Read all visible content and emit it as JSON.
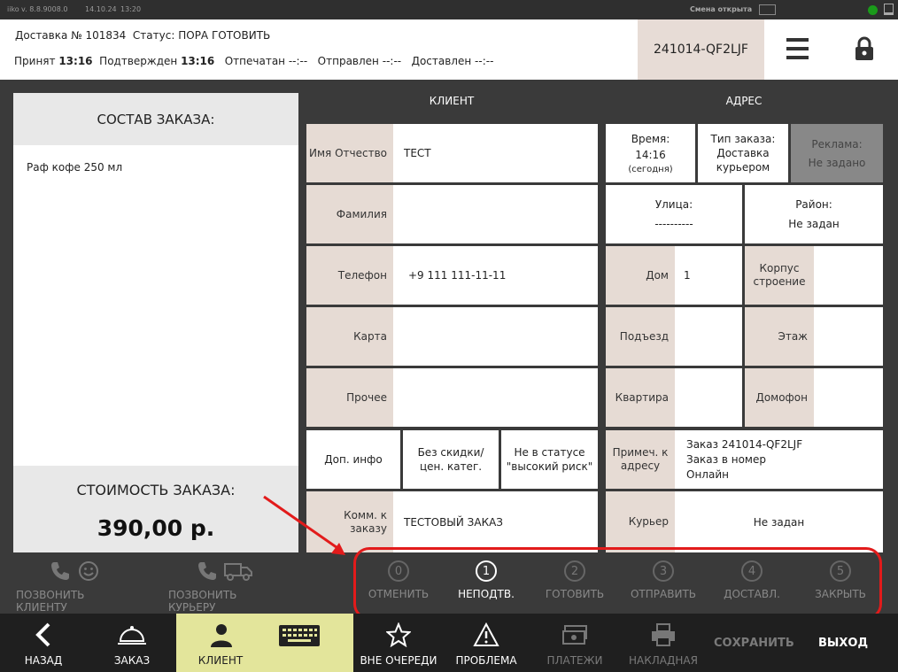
{
  "titlebar": {
    "app": "iiko",
    "version": "v. 8.8.9008.0",
    "date": "14.10.24",
    "time": "13:20",
    "shift": "Смена открыта"
  },
  "header": {
    "delivery_label": "Доставка №",
    "delivery_number": "101834",
    "status_label": "Статус:",
    "status_value": "ПОРА ГОТОВИТЬ",
    "accepted_label": "Принят",
    "accepted_time": "13:16",
    "confirmed_label": "Подтвержден",
    "confirmed_time": "13:16",
    "printed_label": "Отпечатан",
    "printed_time": "--:--",
    "sent_label": "Отправлен",
    "sent_time": "--:--",
    "delivered_label": "Доставлен",
    "delivered_time": "--:--",
    "order_code": "241014-QF2LJF"
  },
  "composition": {
    "title": "СОСТАВ ЗАКАЗА:",
    "items": [
      "Раф  кофе 250 мл"
    ],
    "cost_label": "СТОИМОСТЬ ЗАКАЗА:",
    "cost_value": "390,00 р."
  },
  "client": {
    "title": "КЛИЕНТ",
    "name_label": "Имя Отчество",
    "name_value": "ТЕСТ",
    "surname_label": "Фамилия",
    "surname_value": "",
    "phone_label": "Телефон",
    "phone_value": "+9 111 111-11-11",
    "card_label": "Карта",
    "card_value": "",
    "other_label": "Прочее",
    "other_value": "",
    "extra_info": "Доп. инфо",
    "no_discount": "Без скидки/ цен. катег.",
    "not_risk": "Не в статусе \"высокий риск\"",
    "comment_label": "Комм. к заказу",
    "comment_value": "ТЕСТОВЫЙ ЗАКАЗ"
  },
  "address": {
    "title": "АДРЕС",
    "time_label": "Время:",
    "time_value": "14:16",
    "time_note": "(сегодня)",
    "type_label": "Тип заказа:",
    "type_value": "Доставка курьером",
    "ad_label": "Реклама:",
    "ad_value": "Не задано",
    "street_label": "Улица:",
    "street_value": "----------",
    "district_label": "Район:",
    "district_value": "Не задан",
    "house_label": "Дом",
    "house_value": "1",
    "building_label": "Корпус строение",
    "building_value": "",
    "entrance_label": "Подъезд",
    "entrance_value": "",
    "floor_label": "Этаж",
    "floor_value": "",
    "flat_label": "Квартира",
    "flat_value": "",
    "intercom_label": "Домофон",
    "intercom_value": "",
    "note_label": "Примеч. к адресу",
    "note_lines": [
      "Заказ 241014-QF2LJF",
      "Заказ в номер",
      "Онлайн"
    ],
    "courier_label": "Курьер",
    "courier_value": "Не задан"
  },
  "actions": {
    "call_client": "ПОЗВОНИТЬ КЛИЕНТУ",
    "call_courier": "ПОЗВОНИТЬ КУРЬЕРУ"
  },
  "steps": [
    {
      "num": "0",
      "label": "ОТМЕНИТЬ"
    },
    {
      "num": "1",
      "label": "НЕПОДТВ."
    },
    {
      "num": "2",
      "label": "ГОТОВИТЬ"
    },
    {
      "num": "3",
      "label": "ОТПРАВИТЬ"
    },
    {
      "num": "4",
      "label": "ДОСТАВЛ."
    },
    {
      "num": "5",
      "label": "ЗАКРЫТЬ"
    }
  ],
  "bottom": {
    "back": "НАЗАД",
    "order": "ЗАКАЗ",
    "client": "КЛИЕНТ",
    "out_of_turn": "ВНЕ ОЧЕРЕДИ",
    "problem": "ПРОБЛЕМА",
    "payments": "ПЛАТЕЖИ",
    "invoice": "НАКЛАДНАЯ",
    "save": "СОХРАНИТЬ",
    "exit": "ВЫХОД"
  },
  "colors": {
    "label_bg": "#e6dbd4",
    "client_tab": "#e3e59b",
    "active_step": "#ffffff",
    "annotation_red": "#e21b1b"
  }
}
